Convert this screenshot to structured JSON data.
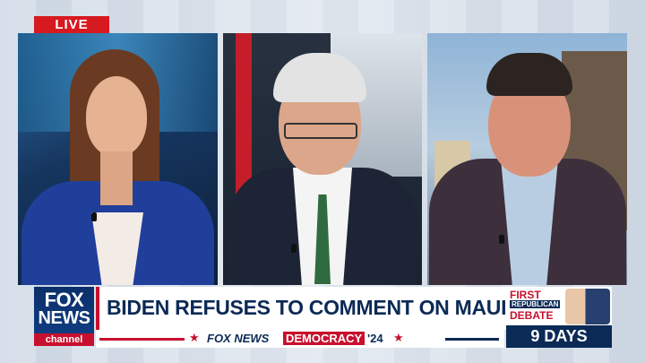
{
  "live_badge": "LIVE",
  "headline": "BIDEN REFUSES TO COMMENT ON MAUI WILDFIRE",
  "logo": {
    "line1": "FOX",
    "line2": "NEWS",
    "line3": "channel"
  },
  "ticker": {
    "network": "FOX NEWS",
    "label": "DEMOCRACY",
    "year": "'24"
  },
  "promo": {
    "line1": "FIRST",
    "line2": "REPUBLICAN",
    "line3": "DEBATE",
    "countdown": "9 DAYS"
  },
  "colors": {
    "fox_blue": "#0b2a55",
    "fox_red": "#c8102e",
    "live_red": "#d71920"
  },
  "icons": [
    "star-icon",
    "fox-news-logo"
  ]
}
